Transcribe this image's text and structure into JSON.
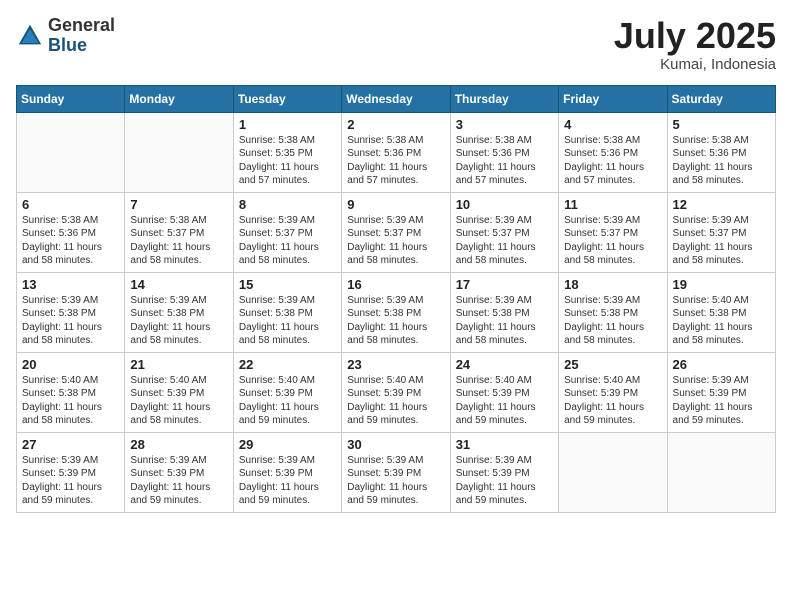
{
  "logo": {
    "general": "General",
    "blue": "Blue"
  },
  "title": "July 2025",
  "location": "Kumai, Indonesia",
  "headers": [
    "Sunday",
    "Monday",
    "Tuesday",
    "Wednesday",
    "Thursday",
    "Friday",
    "Saturday"
  ],
  "weeks": [
    [
      {
        "day": "",
        "info": ""
      },
      {
        "day": "",
        "info": ""
      },
      {
        "day": "1",
        "sunrise": "5:38 AM",
        "sunset": "5:35 PM",
        "daylight": "11 hours and 57 minutes."
      },
      {
        "day": "2",
        "sunrise": "5:38 AM",
        "sunset": "5:36 PM",
        "daylight": "11 hours and 57 minutes."
      },
      {
        "day": "3",
        "sunrise": "5:38 AM",
        "sunset": "5:36 PM",
        "daylight": "11 hours and 57 minutes."
      },
      {
        "day": "4",
        "sunrise": "5:38 AM",
        "sunset": "5:36 PM",
        "daylight": "11 hours and 57 minutes."
      },
      {
        "day": "5",
        "sunrise": "5:38 AM",
        "sunset": "5:36 PM",
        "daylight": "11 hours and 58 minutes."
      }
    ],
    [
      {
        "day": "6",
        "sunrise": "5:38 AM",
        "sunset": "5:36 PM",
        "daylight": "11 hours and 58 minutes."
      },
      {
        "day": "7",
        "sunrise": "5:38 AM",
        "sunset": "5:37 PM",
        "daylight": "11 hours and 58 minutes."
      },
      {
        "day": "8",
        "sunrise": "5:39 AM",
        "sunset": "5:37 PM",
        "daylight": "11 hours and 58 minutes."
      },
      {
        "day": "9",
        "sunrise": "5:39 AM",
        "sunset": "5:37 PM",
        "daylight": "11 hours and 58 minutes."
      },
      {
        "day": "10",
        "sunrise": "5:39 AM",
        "sunset": "5:37 PM",
        "daylight": "11 hours and 58 minutes."
      },
      {
        "day": "11",
        "sunrise": "5:39 AM",
        "sunset": "5:37 PM",
        "daylight": "11 hours and 58 minutes."
      },
      {
        "day": "12",
        "sunrise": "5:39 AM",
        "sunset": "5:37 PM",
        "daylight": "11 hours and 58 minutes."
      }
    ],
    [
      {
        "day": "13",
        "sunrise": "5:39 AM",
        "sunset": "5:38 PM",
        "daylight": "11 hours and 58 minutes."
      },
      {
        "day": "14",
        "sunrise": "5:39 AM",
        "sunset": "5:38 PM",
        "daylight": "11 hours and 58 minutes."
      },
      {
        "day": "15",
        "sunrise": "5:39 AM",
        "sunset": "5:38 PM",
        "daylight": "11 hours and 58 minutes."
      },
      {
        "day": "16",
        "sunrise": "5:39 AM",
        "sunset": "5:38 PM",
        "daylight": "11 hours and 58 minutes."
      },
      {
        "day": "17",
        "sunrise": "5:39 AM",
        "sunset": "5:38 PM",
        "daylight": "11 hours and 58 minutes."
      },
      {
        "day": "18",
        "sunrise": "5:39 AM",
        "sunset": "5:38 PM",
        "daylight": "11 hours and 58 minutes."
      },
      {
        "day": "19",
        "sunrise": "5:40 AM",
        "sunset": "5:38 PM",
        "daylight": "11 hours and 58 minutes."
      }
    ],
    [
      {
        "day": "20",
        "sunrise": "5:40 AM",
        "sunset": "5:38 PM",
        "daylight": "11 hours and 58 minutes."
      },
      {
        "day": "21",
        "sunrise": "5:40 AM",
        "sunset": "5:39 PM",
        "daylight": "11 hours and 58 minutes."
      },
      {
        "day": "22",
        "sunrise": "5:40 AM",
        "sunset": "5:39 PM",
        "daylight": "11 hours and 59 minutes."
      },
      {
        "day": "23",
        "sunrise": "5:40 AM",
        "sunset": "5:39 PM",
        "daylight": "11 hours and 59 minutes."
      },
      {
        "day": "24",
        "sunrise": "5:40 AM",
        "sunset": "5:39 PM",
        "daylight": "11 hours and 59 minutes."
      },
      {
        "day": "25",
        "sunrise": "5:40 AM",
        "sunset": "5:39 PM",
        "daylight": "11 hours and 59 minutes."
      },
      {
        "day": "26",
        "sunrise": "5:39 AM",
        "sunset": "5:39 PM",
        "daylight": "11 hours and 59 minutes."
      }
    ],
    [
      {
        "day": "27",
        "sunrise": "5:39 AM",
        "sunset": "5:39 PM",
        "daylight": "11 hours and 59 minutes."
      },
      {
        "day": "28",
        "sunrise": "5:39 AM",
        "sunset": "5:39 PM",
        "daylight": "11 hours and 59 minutes."
      },
      {
        "day": "29",
        "sunrise": "5:39 AM",
        "sunset": "5:39 PM",
        "daylight": "11 hours and 59 minutes."
      },
      {
        "day": "30",
        "sunrise": "5:39 AM",
        "sunset": "5:39 PM",
        "daylight": "11 hours and 59 minutes."
      },
      {
        "day": "31",
        "sunrise": "5:39 AM",
        "sunset": "5:39 PM",
        "daylight": "11 hours and 59 minutes."
      },
      {
        "day": "",
        "info": ""
      },
      {
        "day": "",
        "info": ""
      }
    ]
  ]
}
